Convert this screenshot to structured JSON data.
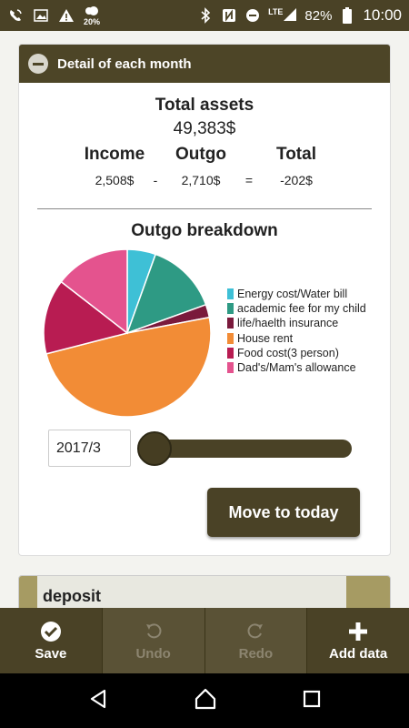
{
  "statusbar": {
    "weather_label": "20%",
    "network_label": "LTE",
    "battery": "82%",
    "time": "10:00",
    "icons": [
      "wifi-calling-icon",
      "image-icon",
      "warning-icon",
      "weather-icon",
      "bluetooth-icon",
      "nfc-icon",
      "dnd-icon",
      "signal-icon",
      "battery-icon"
    ]
  },
  "card": {
    "header_title": "Detail of each month",
    "assets_title": "Total assets",
    "assets_value": "49,383$",
    "income_label": "Income",
    "outgo_label": "Outgo",
    "total_label": "Total",
    "income_value": "2,508$",
    "minus_sign": "-",
    "outgo_value": "2,710$",
    "equals_sign": "=",
    "total_value": "-202$",
    "breakdown_title": "Outgo breakdown",
    "date_value": "2017/3",
    "today_button": "Move to today"
  },
  "chart_data": {
    "type": "pie",
    "title": "Outgo breakdown",
    "legend_position": "right",
    "series": [
      {
        "name": "Energy cost/Water bill",
        "value": 5.5,
        "color": "#3ec0d6"
      },
      {
        "name": "academic fee for my child",
        "value": 14,
        "color": "#2e9a84"
      },
      {
        "name": "life/haelth insurance",
        "value": 2.5,
        "color": "#7a1a3c"
      },
      {
        "name": "House rent",
        "value": 49,
        "color": "#f28c36"
      },
      {
        "name": "Food cost(3 person)",
        "value": 14.5,
        "color": "#b81c52"
      },
      {
        "name": "Dad's/Mam's allowance",
        "value": 14.5,
        "color": "#e4538e"
      }
    ]
  },
  "deposit": {
    "label": "deposit"
  },
  "toolbar": {
    "save_label": "Save",
    "undo_label": "Undo",
    "redo_label": "Redo",
    "add_label": "Add data"
  }
}
